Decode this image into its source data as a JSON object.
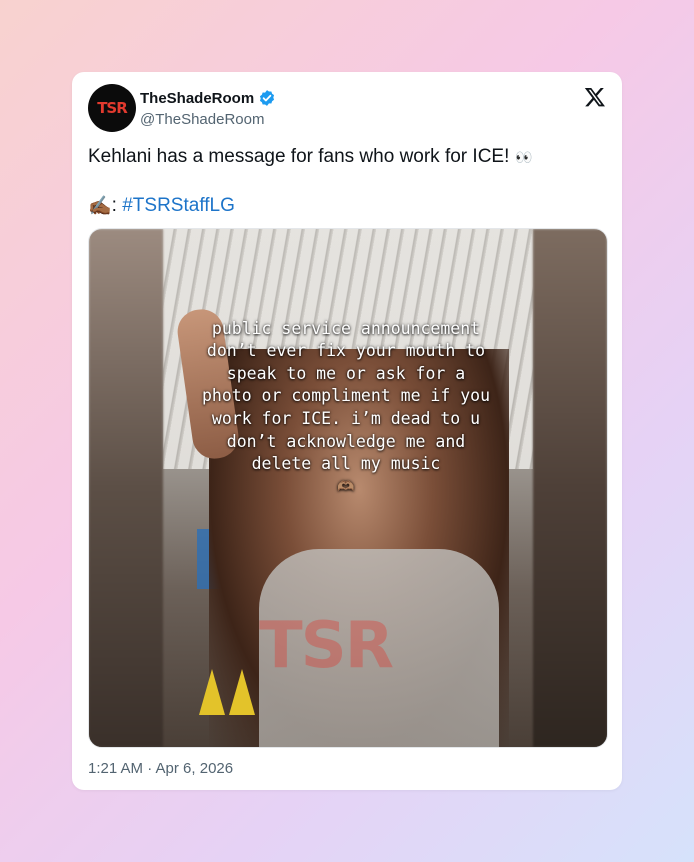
{
  "tweet": {
    "author_name": "TheShadeRoom",
    "author_handle": "@TheShadeRoom",
    "avatar_text": "TSR",
    "text": "Kehlani has a message for fans who work for ICE!",
    "text_emoji": "👀",
    "credit_emoji": "✍🏾",
    "credit_separator": ":",
    "hashtag": "#TSRStaffLG",
    "timestamp": "1:21 AM · Apr 6, 2026"
  },
  "media": {
    "overlay_text": "public service announcement don’t ever fix your mouth to speak to me or ask for a photo or compliment me if you work for ICE. i’m dead to u don’t acknowledge me and delete all my music",
    "overlay_emoji": "🫶🏽",
    "watermark_text": "TSR"
  },
  "colors": {
    "hashtag": "#1d74c9",
    "verified": "#1d9bf0",
    "secondary_text": "#536471",
    "brand_red": "#e23a2e"
  },
  "icons": [
    "verified-badge-icon",
    "x-logo-icon"
  ]
}
